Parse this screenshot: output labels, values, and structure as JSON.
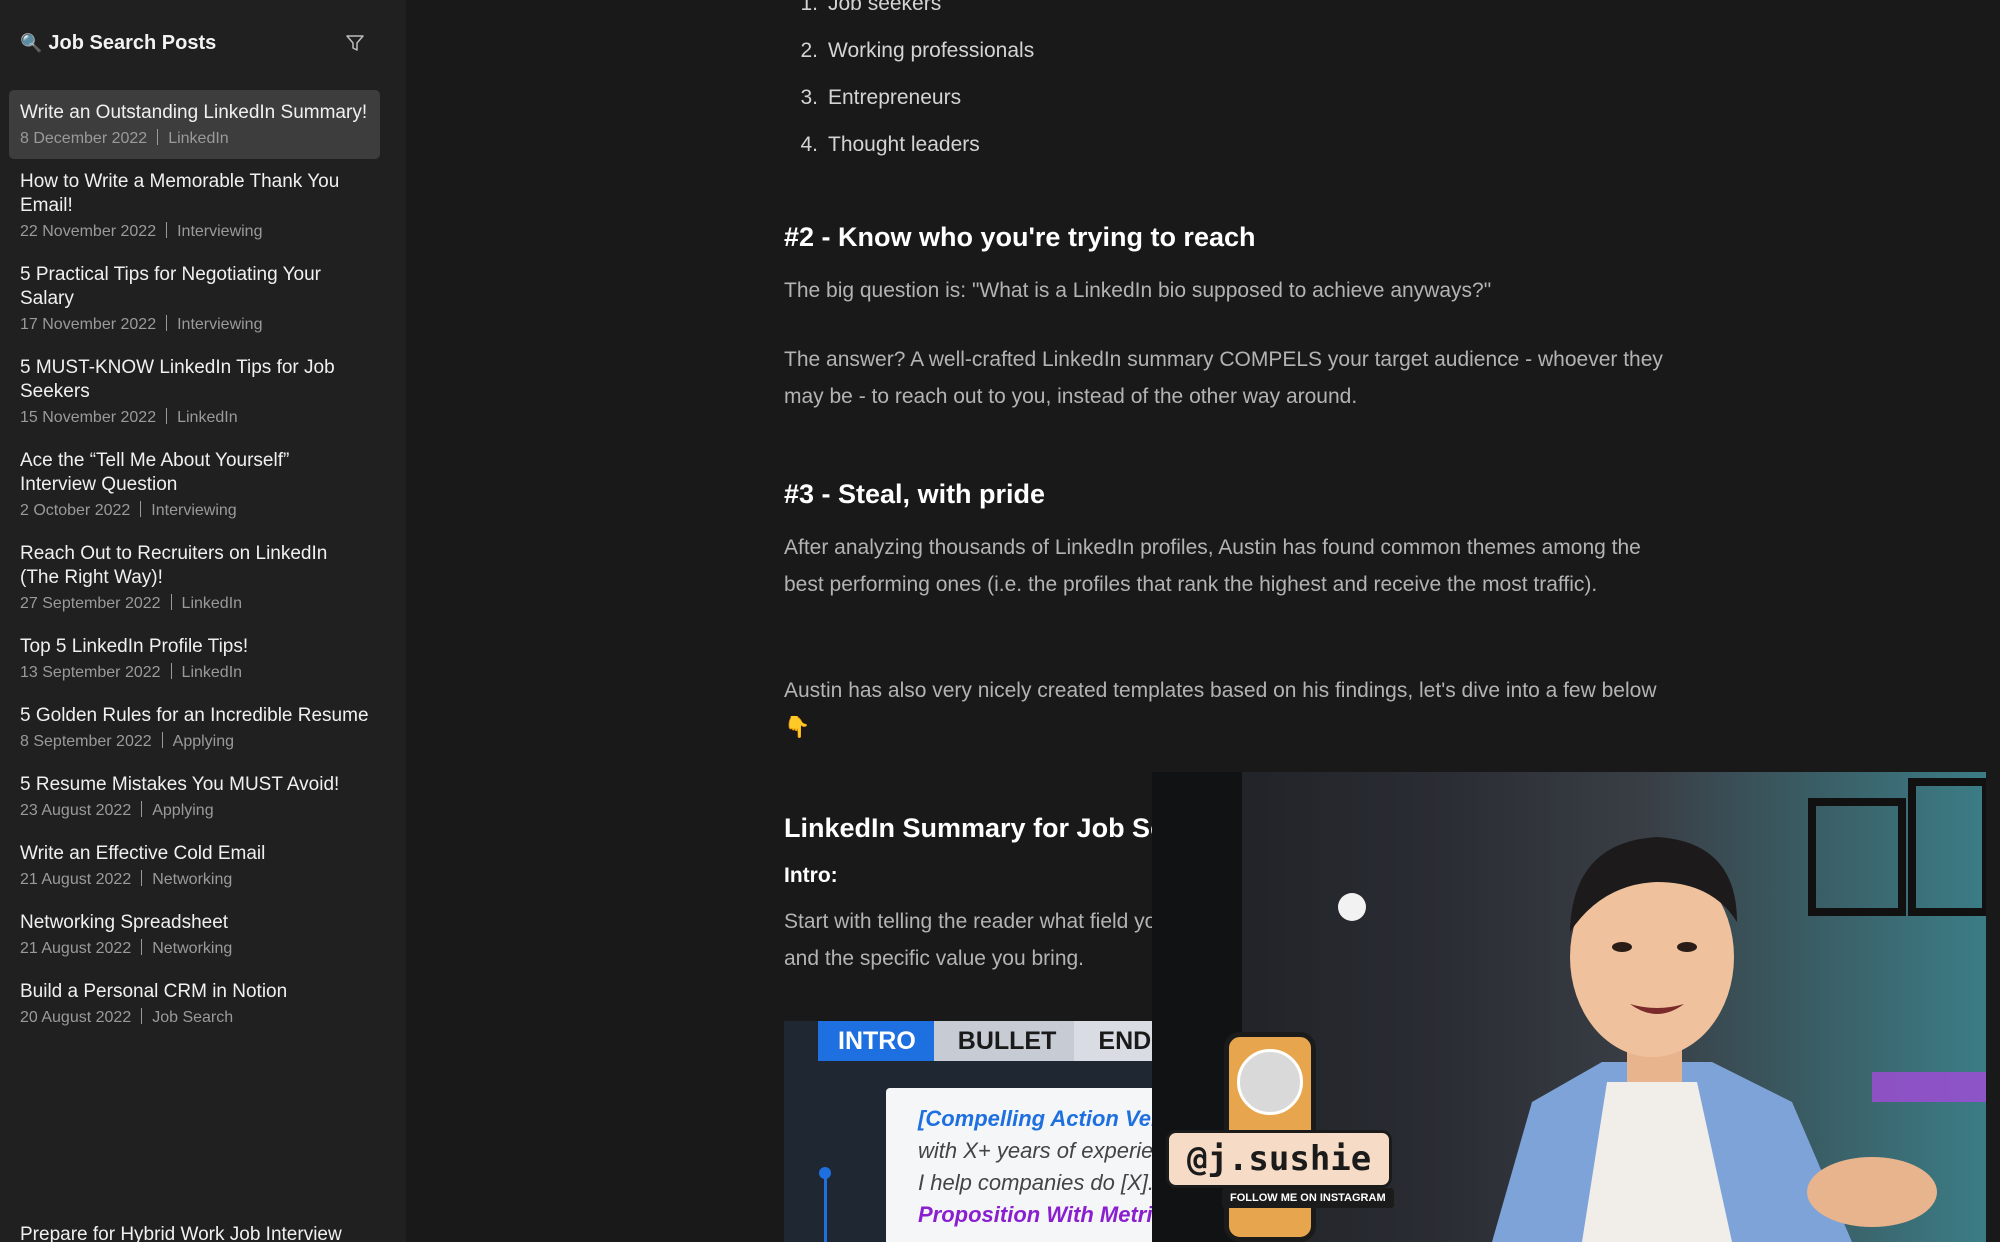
{
  "sidebar": {
    "title": "Job Search Posts",
    "posts": [
      {
        "title": "Write an Outstanding LinkedIn Summary!",
        "date": "8 December 2022",
        "tag": "LinkedIn"
      },
      {
        "title": "How to Write a Memorable Thank You Email!",
        "date": "22 November 2022",
        "tag": "Interviewing"
      },
      {
        "title": "5 Practical Tips for Negotiating Your Salary",
        "date": "17 November 2022",
        "tag": "Interviewing"
      },
      {
        "title": "5 MUST-KNOW LinkedIn Tips for Job Seekers",
        "date": "15 November 2022",
        "tag": "LinkedIn"
      },
      {
        "title": "Ace the “Tell Me About Yourself” Interview Question",
        "date": "2 October 2022",
        "tag": "Interviewing"
      },
      {
        "title": "Reach Out to Recruiters on LinkedIn (The Right Way)!",
        "date": "27 September 2022",
        "tag": "LinkedIn"
      },
      {
        "title": "Top 5 LinkedIn Profile Tips!",
        "date": "13 September 2022",
        "tag": "LinkedIn"
      },
      {
        "title": "5 Golden Rules for an Incredible Resume",
        "date": "8 September 2022",
        "tag": "Applying"
      },
      {
        "title": "5 Resume Mistakes You MUST Avoid!",
        "date": "23 August 2022",
        "tag": "Applying"
      },
      {
        "title": "Write an Effective Cold Email",
        "date": "21 August 2022",
        "tag": "Networking"
      },
      {
        "title": "Networking Spreadsheet",
        "date": "21 August 2022",
        "tag": "Networking"
      },
      {
        "title": "Build a Personal CRM in Notion",
        "date": "20 August 2022",
        "tag": "Job Search"
      }
    ],
    "truncated_item": "Prepare for Hybrid Work Job Interview"
  },
  "article": {
    "list": [
      {
        "n": "1.",
        "text": "Job seekers"
      },
      {
        "n": "2.",
        "text": "Working professionals"
      },
      {
        "n": "3.",
        "text": "Entrepreneurs"
      },
      {
        "n": "4.",
        "text": "Thought leaders"
      }
    ],
    "h2": "#2 - Know who you're trying to reach",
    "p2a": "The big question is: \"What is a LinkedIn bio supposed to achieve anyways?\"",
    "p2b": "The answer? A well-crafted LinkedIn summary COMPELS your target audience - whoever they may be - to reach out to you, instead of the other way around.",
    "h3": "#3 - Steal, with pride",
    "p3a": "After analyzing thousands of LinkedIn profiles, Austin has found common themes among the best performing ones (i.e. the profiles that rank the highest and receive the most traffic).",
    "p3b": "Austin has also very nicely created templates based on his findings, let's dive into a few below 👇",
    "h4": "LinkedIn Summary for Job Seekers",
    "intro_label": "Intro:",
    "p4": "Start with telling the reader what field you work in, how many years of experience you have and the specific value you bring."
  },
  "template": {
    "tabs": [
      "INTRO",
      "BULLET",
      "END"
    ],
    "line1": "[Compelling Action Verb]",
    "line2": "with X+ years of experience.",
    "line3": "I help companies do [X].",
    "line4": "Proposition With Metrics"
  },
  "video": {
    "handle": "@j.sushie",
    "follow": "FOLLOW ME ON INSTAGRAM"
  },
  "colors": {
    "accent": "#1e6fe0",
    "purple": "#8a1fd0"
  }
}
